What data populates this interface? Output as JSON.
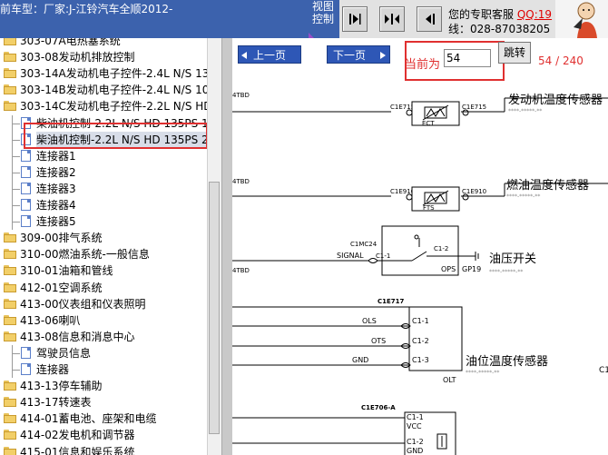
{
  "header": {
    "title": "前车型：厂家:J-江铃汽车全顺2012-",
    "view_control": "视图\n控制",
    "support_text": "您的专职客服",
    "support_qq": "QQ:19",
    "phone": "线：028-87038205"
  },
  "tree": {
    "items": [
      {
        "label": "303-07A电热塞系统",
        "type": "folder"
      },
      {
        "label": "303-08发动机排放控制",
        "type": "folder"
      },
      {
        "label": "303-14A发动机电子控件-2.4L N/S 135",
        "type": "folder"
      },
      {
        "label": "303-14B发动机电子控件-2.4L N/S 100",
        "type": "folder"
      },
      {
        "label": "303-14C发动机电子控件-2.2L N/S HD",
        "type": "folder"
      },
      {
        "label": "柴油机控制-2.2L N/S HD 135PS 1",
        "type": "page"
      },
      {
        "label": "柴油机控制-2.2L N/S HD 135PS 2",
        "type": "page",
        "selected": true
      },
      {
        "label": "连接器1",
        "type": "page"
      },
      {
        "label": "连接器2",
        "type": "page"
      },
      {
        "label": "连接器3",
        "type": "page"
      },
      {
        "label": "连接器4",
        "type": "page"
      },
      {
        "label": "连接器5",
        "type": "page"
      },
      {
        "label": "309-00排气系统",
        "type": "folder"
      },
      {
        "label": "310-00燃油系统-一般信息",
        "type": "folder"
      },
      {
        "label": "310-01油箱和管线",
        "type": "folder"
      },
      {
        "label": "412-01空调系统",
        "type": "folder"
      },
      {
        "label": "413-00仪表组和仪表照明",
        "type": "folder"
      },
      {
        "label": "413-06喇叭",
        "type": "folder"
      },
      {
        "label": "413-08信息和消息中心",
        "type": "folder"
      },
      {
        "label": "驾驶员信息",
        "type": "page"
      },
      {
        "label": "连接器",
        "type": "page"
      },
      {
        "label": "413-13停车辅助",
        "type": "folder"
      },
      {
        "label": "413-17转速表",
        "type": "folder"
      },
      {
        "label": "414-01蓄电池、座架和电缆",
        "type": "folder"
      },
      {
        "label": "414-02发电机和调节器",
        "type": "folder"
      },
      {
        "label": "415-01信息和娱乐系统",
        "type": "folder"
      }
    ]
  },
  "toolbar": {
    "prev_label": "上一页",
    "next_label": "下一页",
    "current_label": "当前为",
    "page_value": "54",
    "go_label": "跳转",
    "page_count": "54 / 240"
  },
  "schematic": {
    "components": [
      {
        "name": "发动机温度传感器",
        "code": "****-*****-**",
        "pin_left": "C1E715",
        "pin_right": "C1E715",
        "inner": "ECT",
        "wire": "4TBD"
      },
      {
        "name": "燃油温度传感器",
        "code": "****-*****-**",
        "pin_left": "C1E910",
        "pin_right": "C1E910",
        "inner": "FTS",
        "wire": "4TBD"
      },
      {
        "name": "油压开关",
        "code": "****-*****-**",
        "conn": "C1MC24",
        "sig": "SIGNAL",
        "p1": "C1-1",
        "p2": "C1-2",
        "inner": "OPS",
        "ground": "GP19",
        "wire": "4TBD"
      },
      {
        "name": "油位温度传感器",
        "code": "****-*****-**",
        "conn": "C1E717",
        "pins": [
          "OLS",
          "OTS",
          "GND"
        ],
        "pinlabels": [
          "C1-1",
          "C1-2",
          "C1-3"
        ],
        "inner": "OLT"
      },
      {
        "conn": "C1E706-A",
        "pins": [
          "VCC",
          "GND"
        ],
        "pinlabels": [
          "C1-1",
          "C1-2"
        ]
      }
    ],
    "edge_label": "C1"
  },
  "colors": {
    "title_bg": "#3c62ad",
    "highlight": "#e03030",
    "button_bg": "#2e57b6"
  }
}
